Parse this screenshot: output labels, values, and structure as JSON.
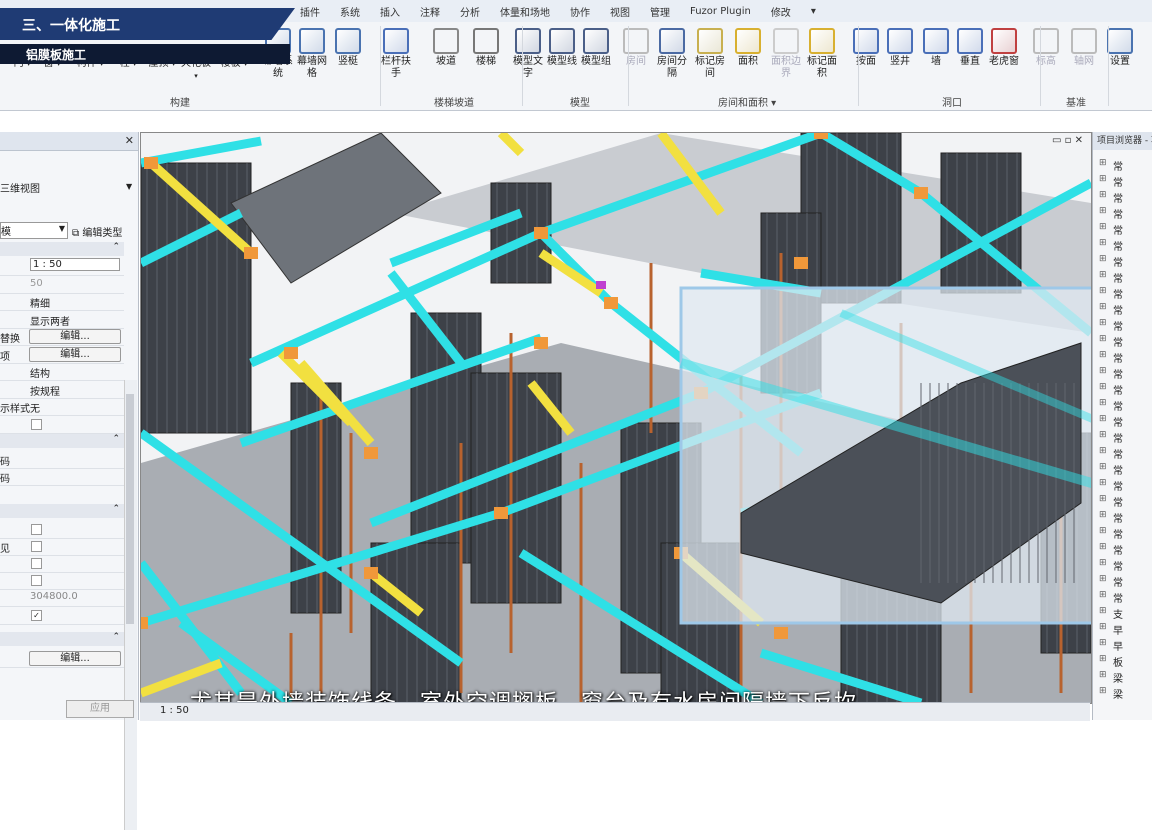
{
  "menu": [
    "插件",
    "系统",
    "插入",
    "注释",
    "分析",
    "体量和场地",
    "协作",
    "视图",
    "管理",
    "Fuzor Plugin",
    "修改",
    "▾"
  ],
  "banner": {
    "title": "三、一体化施工",
    "subtitle": "铝膜板施工"
  },
  "ribbon": {
    "tools": [
      {
        "id": "door",
        "label": "门"
      },
      {
        "id": "window",
        "label": "窗"
      },
      {
        "id": "component",
        "label": "构件"
      },
      {
        "id": "column",
        "label": "柱"
      },
      {
        "id": "roof",
        "label": "屋顶"
      },
      {
        "id": "ceiling",
        "label": "天花板"
      },
      {
        "id": "floor",
        "label": "楼板"
      },
      {
        "id": "curtain-system",
        "label": "幕墙系统"
      },
      {
        "id": "curtain-grid",
        "label": "幕墙网格"
      },
      {
        "id": "mullion",
        "label": "竖梃"
      },
      {
        "id": "railing",
        "label": "栏杆扶手"
      },
      {
        "id": "ramp",
        "label": "坡道"
      },
      {
        "id": "stair",
        "label": "楼梯"
      },
      {
        "id": "model-text",
        "label": "模型文字"
      },
      {
        "id": "model-line",
        "label": "模型线"
      },
      {
        "id": "model-group",
        "label": "模型组"
      },
      {
        "id": "room",
        "label": "房间"
      },
      {
        "id": "room-separator",
        "label": "房间分隔"
      },
      {
        "id": "tag-room",
        "label": "标记房间"
      },
      {
        "id": "area",
        "label": "面积"
      },
      {
        "id": "area-boundary",
        "label": "面积边界"
      },
      {
        "id": "tag-area",
        "label": "标记面积"
      },
      {
        "id": "by-face",
        "label": "按面"
      },
      {
        "id": "shaft",
        "label": "竖井"
      },
      {
        "id": "wall-opening",
        "label": "墙"
      },
      {
        "id": "vertical",
        "label": "垂直"
      },
      {
        "id": "dormer",
        "label": "老虎窗"
      },
      {
        "id": "level",
        "label": "标高"
      },
      {
        "id": "grid",
        "label": "轴网"
      },
      {
        "id": "set",
        "label": "设置"
      }
    ],
    "groups": [
      "构建",
      "楼梯坡道",
      "模型",
      "房间和面积 ▾",
      "洞口",
      "基准"
    ]
  },
  "properties": {
    "close": "✕",
    "view_type": "三维视图",
    "dropdown": "模",
    "edit_type": "编辑类型",
    "rows": [
      {
        "k": "",
        "v": "1 : 50"
      },
      {
        "k": "",
        "v": "50"
      },
      {
        "k": "",
        "v": "精细"
      },
      {
        "k": "",
        "v": "显示两者"
      },
      {
        "k": "替换",
        "btn": "编辑..."
      },
      {
        "k": "项",
        "btn": "编辑..."
      },
      {
        "k": "",
        "v": "结构"
      },
      {
        "k": "",
        "v": "按规程"
      },
      {
        "k": "示样式",
        "v": "无"
      }
    ],
    "rows2": [
      {
        "k": "码"
      },
      {
        "k": "码"
      }
    ],
    "rows3": [
      {
        "k": "",
        "v": ""
      },
      {
        "k": "见",
        "v": ""
      },
      {
        "k": "",
        "v": ""
      },
      {
        "k": "",
        "v": ""
      },
      {
        "k": "",
        "v": "304800.0"
      },
      {
        "k": "",
        "v": "✓"
      }
    ],
    "edit_last": "编辑...",
    "apply": "应用"
  },
  "viewport": {
    "controls": "▭ ▫ ✕"
  },
  "status": {
    "scale": "1 : 50"
  },
  "subtitle": "尤其是外墙装饰线条、室外空调搁板、窗台及有水房间隔墙下反坎",
  "browser": {
    "title": "项目浏览器 - 项目",
    "items": [
      "常",
      "常",
      "常",
      "常",
      "常",
      "常",
      "常",
      "常",
      "常",
      "常",
      "常",
      "常",
      "常",
      "常",
      "常",
      "常",
      "常",
      "常",
      "常",
      "常",
      "常",
      "常",
      "常",
      "常",
      "常",
      "常",
      "常",
      "常",
      "支",
      "早",
      "早",
      "板",
      "梁",
      "梁"
    ]
  },
  "colors": {
    "beam_cyan": "#2fe0e6",
    "beam_yellow": "#f2e040",
    "joint_orange": "#f0983a",
    "formwork": "#3d4148",
    "prop": "#b8622e"
  }
}
